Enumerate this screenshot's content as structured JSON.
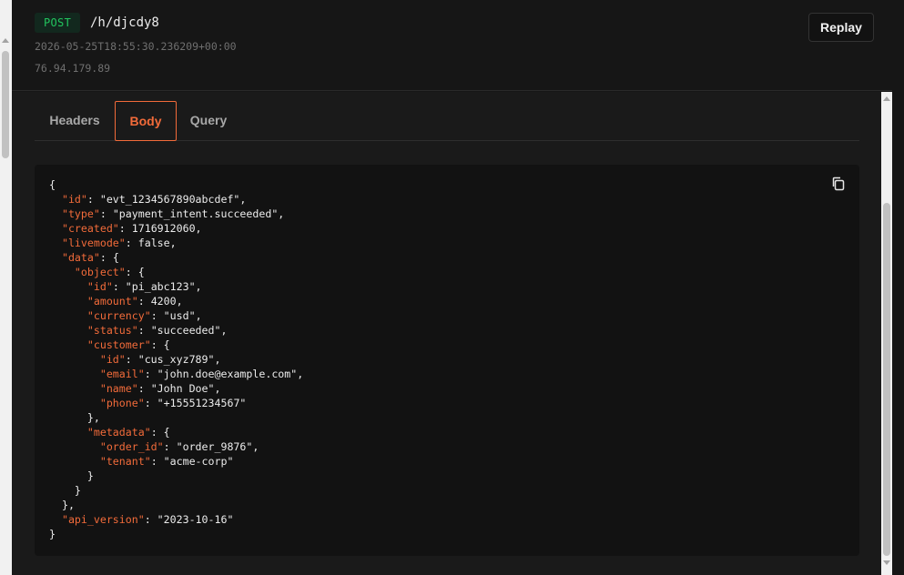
{
  "request": {
    "method": "POST",
    "path": "/h/djcdy8",
    "timestamp": "2026-05-25T18:55:30.236209+00:00",
    "ip": "76.94.179.89",
    "replay_label": "Replay"
  },
  "tabs": [
    {
      "label": "Headers",
      "active": false
    },
    {
      "label": "Body",
      "active": true
    },
    {
      "label": "Query",
      "active": false
    }
  ],
  "body_json_lines": [
    [
      [
        "p",
        "{"
      ]
    ],
    [
      [
        "p",
        "  "
      ],
      [
        "k",
        "\"id\""
      ],
      [
        "p",
        ": \"evt_1234567890abcdef\","
      ]
    ],
    [
      [
        "p",
        "  "
      ],
      [
        "k",
        "\"type\""
      ],
      [
        "p",
        ": \"payment_intent.succeeded\","
      ]
    ],
    [
      [
        "p",
        "  "
      ],
      [
        "k",
        "\"created\""
      ],
      [
        "p",
        ": 1716912060,"
      ]
    ],
    [
      [
        "p",
        "  "
      ],
      [
        "k",
        "\"livemode\""
      ],
      [
        "p",
        ": false,"
      ]
    ],
    [
      [
        "p",
        "  "
      ],
      [
        "k",
        "\"data\""
      ],
      [
        "p",
        ": {"
      ]
    ],
    [
      [
        "p",
        "    "
      ],
      [
        "k",
        "\"object\""
      ],
      [
        "p",
        ": {"
      ]
    ],
    [
      [
        "p",
        "      "
      ],
      [
        "k",
        "\"id\""
      ],
      [
        "p",
        ": \"pi_abc123\","
      ]
    ],
    [
      [
        "p",
        "      "
      ],
      [
        "k",
        "\"amount\""
      ],
      [
        "p",
        ": 4200,"
      ]
    ],
    [
      [
        "p",
        "      "
      ],
      [
        "k",
        "\"currency\""
      ],
      [
        "p",
        ": \"usd\","
      ]
    ],
    [
      [
        "p",
        "      "
      ],
      [
        "k",
        "\"status\""
      ],
      [
        "p",
        ": \"succeeded\","
      ]
    ],
    [
      [
        "p",
        "      "
      ],
      [
        "k",
        "\"customer\""
      ],
      [
        "p",
        ": {"
      ]
    ],
    [
      [
        "p",
        "        "
      ],
      [
        "k",
        "\"id\""
      ],
      [
        "p",
        ": \"cus_xyz789\","
      ]
    ],
    [
      [
        "p",
        "        "
      ],
      [
        "k",
        "\"email\""
      ],
      [
        "p",
        ": \"john.doe@example.com\","
      ]
    ],
    [
      [
        "p",
        "        "
      ],
      [
        "k",
        "\"name\""
      ],
      [
        "p",
        ": \"John Doe\","
      ]
    ],
    [
      [
        "p",
        "        "
      ],
      [
        "k",
        "\"phone\""
      ],
      [
        "p",
        ": \"+15551234567\""
      ]
    ],
    [
      [
        "p",
        "      },"
      ]
    ],
    [
      [
        "p",
        "      "
      ],
      [
        "k",
        "\"metadata\""
      ],
      [
        "p",
        ": {"
      ]
    ],
    [
      [
        "p",
        "        "
      ],
      [
        "k",
        "\"order_id\""
      ],
      [
        "p",
        ": \"order_9876\","
      ]
    ],
    [
      [
        "p",
        "        "
      ],
      [
        "k",
        "\"tenant\""
      ],
      [
        "p",
        ": \"acme-corp\""
      ]
    ],
    [
      [
        "p",
        "      }"
      ]
    ],
    [
      [
        "p",
        "    }"
      ]
    ],
    [
      [
        "p",
        "  },"
      ]
    ],
    [
      [
        "p",
        "  "
      ],
      [
        "k",
        "\"api_version\""
      ],
      [
        "p",
        ": \"2023-10-16\""
      ]
    ],
    [
      [
        "p",
        "}"
      ]
    ]
  ],
  "colors": {
    "accent": "#f26b3a",
    "method_green": "#22c55e",
    "background": "#161616"
  },
  "icons": {
    "copy": "copy-icon"
  }
}
